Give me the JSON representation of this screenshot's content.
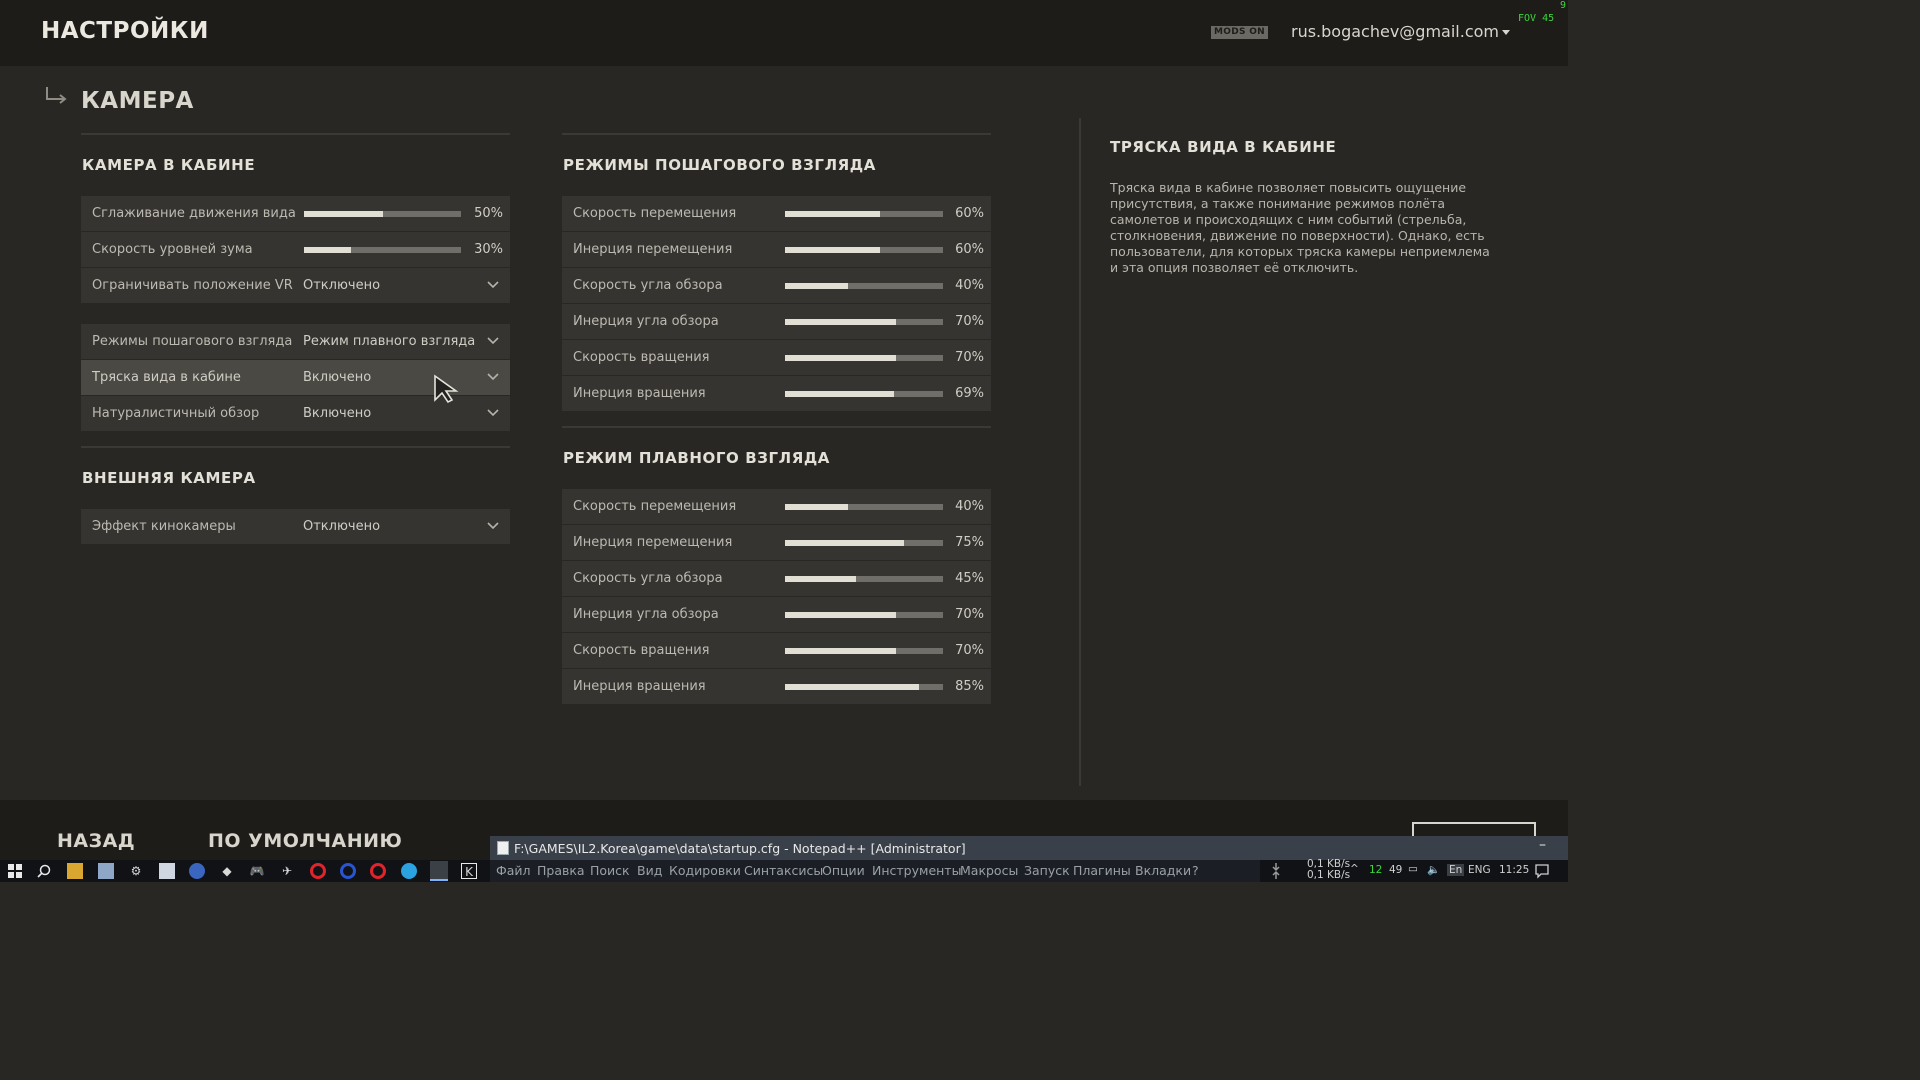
{
  "header": {
    "title": "НАСТРОЙКИ",
    "mods_badge": "MODS ON",
    "account": "rus.bogachev@gmail.com",
    "fps": "9",
    "fov": "FOV 45"
  },
  "page": {
    "title": "КАМЕРА"
  },
  "cockpit_camera": {
    "title": "КАМЕРА В КАБИНЕ",
    "sliders": [
      {
        "label": "Сглаживание движения вида",
        "value": 50,
        "value_text": "50%"
      },
      {
        "label": "Скорость уровней зума",
        "value": 30,
        "value_text": "30%"
      }
    ],
    "vr_dropdown": {
      "label": "Ограничивать положение VR",
      "value": "Отключено"
    },
    "dropdowns": [
      {
        "label": "Режимы пошагового взгляда",
        "value": "Режим плавного взгляда"
      },
      {
        "label": "Тряска вида в кабине",
        "value": "Включено"
      },
      {
        "label": "Натуралистичный обзор",
        "value": "Включено"
      }
    ]
  },
  "external_camera": {
    "title": "ВНЕШНЯЯ КАМЕРА",
    "dropdown": {
      "label": "Эффект кинокамеры",
      "value": "Отключено"
    }
  },
  "step_view": {
    "title": "РЕЖИМЫ ПОШАГОВОГО ВЗГЛЯДА",
    "sliders": [
      {
        "label": "Скорость перемещения",
        "value": 60,
        "value_text": "60%"
      },
      {
        "label": "Инерция перемещения",
        "value": 60,
        "value_text": "60%"
      },
      {
        "label": "Скорость угла обзора",
        "value": 40,
        "value_text": "40%"
      },
      {
        "label": "Инерция угла обзора",
        "value": 70,
        "value_text": "70%"
      },
      {
        "label": "Скорость вращения",
        "value": 70,
        "value_text": "70%"
      },
      {
        "label": "Инерция вращения",
        "value": 69,
        "value_text": "69%"
      }
    ]
  },
  "smooth_view": {
    "title": "РЕЖИМ ПЛАВНОГО ВЗГЛЯДА",
    "sliders": [
      {
        "label": "Скорость перемещения",
        "value": 40,
        "value_text": "40%"
      },
      {
        "label": "Инерция перемещения",
        "value": 75,
        "value_text": "75%"
      },
      {
        "label": "Скорость угла обзора",
        "value": 45,
        "value_text": "45%"
      },
      {
        "label": "Инерция угла обзора",
        "value": 70,
        "value_text": "70%"
      },
      {
        "label": "Скорость вращения",
        "value": 70,
        "value_text": "70%"
      },
      {
        "label": "Инерция вращения",
        "value": 85,
        "value_text": "85%"
      }
    ]
  },
  "info": {
    "title": "ТРЯСКА ВИДА В КАБИНЕ",
    "text": "Тряска вида в кабине позволяет повысить ощущение присутствия, а также понимание режимов полёта самолетов и происходящих с ним событий (стрельба, столкновения, движение по поверхности). Однако, есть пользователи, для которых тряска камеры неприемлема и эта опция позволяет её отключить."
  },
  "footer": {
    "back": "НАЗАД",
    "defaults": "ПО УМОЛЧАНИЮ"
  },
  "notepad": {
    "title": "F:\\GAMES\\IL2.Korea\\game\\data\\startup.cfg - Notepad++ [Administrator]",
    "menu": [
      "Файл",
      "Правка",
      "Поиск",
      "Вид",
      "Кодировки",
      "Синтаксисы",
      "Опции",
      "Инструменты",
      "Макросы",
      "Запуск",
      "Плагины",
      "Вкладки",
      "?"
    ]
  },
  "taskbar": {
    "net_up": "0,1 KB/s",
    "net_down": "0,1 KB/s",
    "num1": "12",
    "num2": "49",
    "lang_short": "En",
    "lang": "ENG",
    "time": "11:25"
  },
  "colors": {
    "background": "#282723",
    "header": "#1d1c19",
    "row": "#353430",
    "row_selected": "#4a4944",
    "slider_fill": "#e1ded4",
    "slider_track": "#6f6e68",
    "fps_text": "#3cd63c"
  }
}
